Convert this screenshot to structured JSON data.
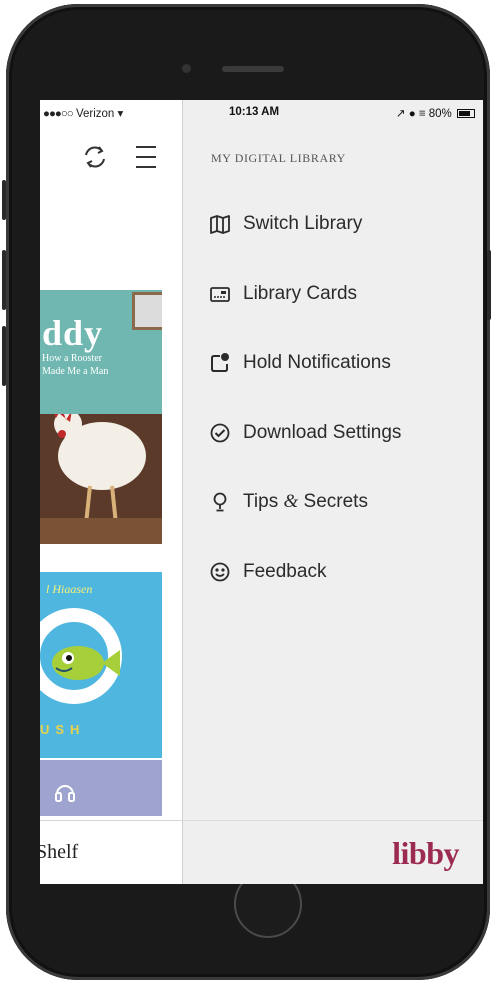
{
  "status_bar": {
    "carrier": "Verizon",
    "time": "10:13 AM",
    "battery": "80%"
  },
  "drawer": {
    "heading": "MY DIGITAL LIBRARY",
    "items": [
      {
        "label": "Switch Library",
        "icon": "map-icon"
      },
      {
        "label": "Library Cards",
        "icon": "card-icon"
      },
      {
        "label": "Hold Notifications",
        "icon": "notification-icon"
      },
      {
        "label": "Download Settings",
        "icon": "download-check-icon"
      },
      {
        "label": "Tips",
        "label_amp": "&",
        "label_tail": "Secrets",
        "icon": "lightbulb-icon"
      },
      {
        "label": "Feedback",
        "icon": "smiley-icon"
      }
    ],
    "brand": "libby"
  },
  "left_panel": {
    "book1": {
      "title": "ddy",
      "subtitle_line1": "How a Rooster",
      "subtitle_line2": "Made Me a Man"
    },
    "book2": {
      "author": "l Hiaasen",
      "title": "USH"
    },
    "shelf_label": "Shelf"
  },
  "colors": {
    "brand": "#9b2b52",
    "drawer_bg": "#efefef",
    "text": "#2b2b2b"
  }
}
